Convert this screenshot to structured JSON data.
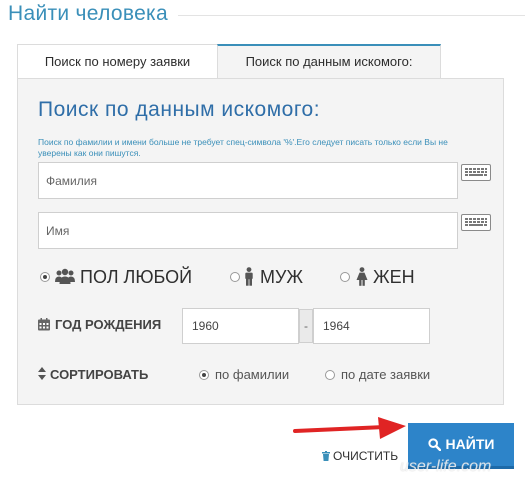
{
  "page": {
    "title": "Найти человека"
  },
  "tabs": [
    {
      "label": "Поиск по номеру заявки",
      "active": false
    },
    {
      "label": "Поиск по данным искомого:",
      "active": true
    }
  ],
  "form": {
    "heading": "Поиск по данным искомого:",
    "hint": "Поиск по фамилии и имени больше не требует спец-символа '%'.Его следует писать только если Вы не уверены как они пишутся.",
    "surname_placeholder": "Фамилия",
    "name_placeholder": "Имя",
    "gender": {
      "options": [
        {
          "label": "ПОЛ ЛЮБОЙ",
          "icon": "users-icon",
          "selected": true
        },
        {
          "label": "МУЖ",
          "icon": "male-icon",
          "selected": false
        },
        {
          "label": "ЖЕН",
          "icon": "female-icon",
          "selected": false
        }
      ]
    },
    "birth_year": {
      "label": "ГОД РОЖДЕНИЯ",
      "from": "1960",
      "separator": "-",
      "to": "1964"
    },
    "sort": {
      "label": "СОРТИРОВАТЬ",
      "options": [
        {
          "label": "по фамилии",
          "selected": true
        },
        {
          "label": "по дате заявки",
          "selected": false
        }
      ]
    }
  },
  "actions": {
    "search_label": "НАЙТИ",
    "clear_label": "ОЧИСТИТЬ"
  },
  "watermark": "user-life.com",
  "colors": {
    "accent": "#3a8fb9",
    "heading": "#2f6ea8",
    "button": "#2d84c9",
    "arrow": "#e02424",
    "panel_bg": "#f4f4f4"
  }
}
